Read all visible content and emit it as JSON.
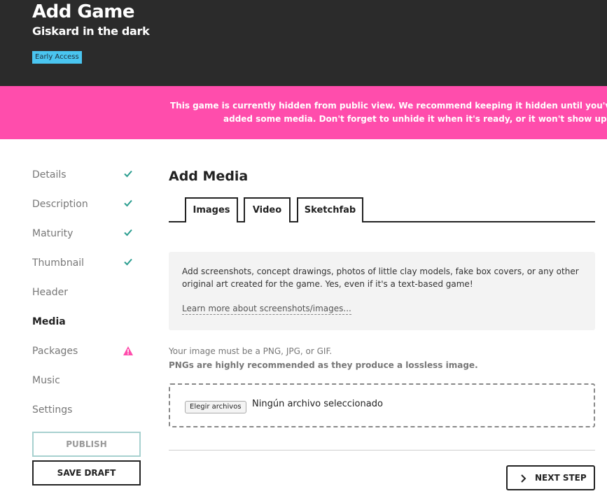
{
  "header": {
    "title": "Add Game",
    "subtitle": "Giskard in the dark",
    "badge": "Early Access"
  },
  "notice": {
    "line1": "This game is currently hidden from public view. We recommend keeping it hidden until you've finished filling",
    "line2": "added some media. Don't forget to unhide it when it's ready, or it won't show up in the game lis"
  },
  "sidebar": {
    "items": [
      {
        "label": "Details",
        "status": "done"
      },
      {
        "label": "Description",
        "status": "done"
      },
      {
        "label": "Maturity",
        "status": "done"
      },
      {
        "label": "Thumbnail",
        "status": "done"
      },
      {
        "label": "Header",
        "status": "none"
      },
      {
        "label": "Media",
        "status": "active"
      },
      {
        "label": "Packages",
        "status": "warning"
      },
      {
        "label": "Music",
        "status": "none"
      },
      {
        "label": "Settings",
        "status": "none"
      }
    ],
    "publish_label": "PUBLISH",
    "save_draft_label": "SAVE DRAFT"
  },
  "main": {
    "title": "Add Media",
    "tabs": [
      {
        "label": "Images",
        "active": true
      },
      {
        "label": "Video",
        "active": false
      },
      {
        "label": "Sketchfab",
        "active": false
      }
    ],
    "info": {
      "text": "Add screenshots, concept drawings, photos of little clay models, fake box covers, or any other original art created for the game. Yes, even if it's a text-based game!",
      "link": "Learn more about screenshots/images..."
    },
    "requirements": {
      "text": "Your image must be a PNG, JPG, or GIF.",
      "strong": "PNGs are highly recommended as they produce a lossless image."
    },
    "file_input": {
      "button_label": "Elegir archivos",
      "status": "Ningún archivo seleccionado"
    },
    "next_step_label": "NEXT STEP"
  },
  "colors": {
    "header_bg": "#2b2b2b",
    "notice_bg": "#ff4dac",
    "badge_bg": "#4ac5f0",
    "check": "#2a9d8f",
    "warning": "#ff4dac"
  }
}
